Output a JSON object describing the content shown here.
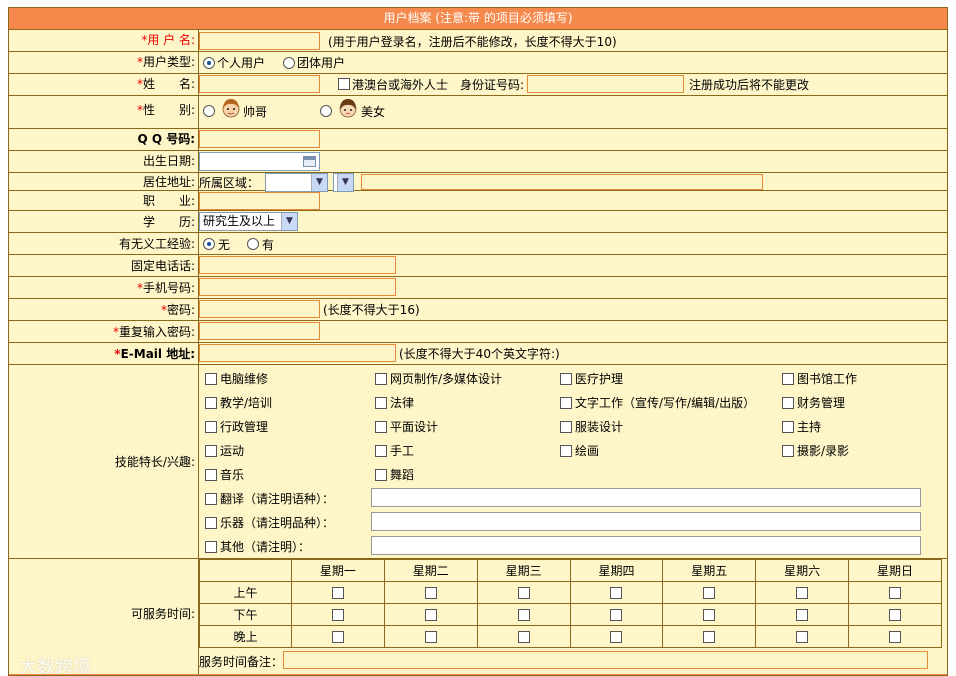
{
  "header": {
    "title": "用户档案 (注意:带 的项目必须填写)"
  },
  "fields": {
    "username": {
      "label": "用 户 名:",
      "hint": "(用于用户登录名，注册后不能修改，长度不得大于10)"
    },
    "usertype": {
      "label": "用户类型:",
      "options": [
        "个人用户",
        "团体用户"
      ],
      "selected": "个人用户"
    },
    "name": {
      "label": "姓　　名:",
      "hk_label": "港澳台或海外人士",
      "id_label": "身份证号码:",
      "id_hint": "注册成功后将不能更改"
    },
    "gender": {
      "label": "性　　别:",
      "options": [
        "帅哥",
        "美女"
      ]
    },
    "qq": {
      "label": "Q Q 号码:"
    },
    "birth": {
      "label": "出生日期:"
    },
    "address": {
      "label": "居住地址:",
      "region_label": "所属区域："
    },
    "job": {
      "label": "职　　业:"
    },
    "education": {
      "label": "学　　历:",
      "value": "研究生及以上"
    },
    "volunteer": {
      "label": "有无义工经验:",
      "options": [
        "无",
        "有"
      ],
      "selected": "无"
    },
    "phone": {
      "label": "固定电话话:"
    },
    "mobile": {
      "label": "手机号码:"
    },
    "password": {
      "label": "密码:",
      "hint": "(长度不得大于16)"
    },
    "password2": {
      "label": "重复输入密码:"
    },
    "email": {
      "label": "E-Mail 地址:",
      "hint": "(长度不得大于40个英文字符:)"
    }
  },
  "required_mark": "*",
  "skills": {
    "label": "技能特长/兴趣:",
    "items": [
      "电脑维修",
      "网页制作/多媒体设计",
      "医疗护理",
      "图书馆工作",
      "教学/培训",
      "法律",
      "文字工作（宣传/写作/编辑/出版）",
      "财务管理",
      "行政管理",
      "平面设计",
      "服装设计",
      "主持",
      "运动",
      "手工",
      "绘画",
      "摄影/录影",
      "音乐",
      "舞蹈"
    ],
    "other_items": [
      "翻译（请注明语种）：",
      "乐器（请注明品种）：",
      "其他（请注明）："
    ]
  },
  "schedule": {
    "label": "可服务时间:",
    "days": [
      "星期一",
      "星期二",
      "星期三",
      "星期四",
      "星期五",
      "星期六",
      "星期日"
    ],
    "slots": [
      "上午",
      "下午",
      "晚上"
    ],
    "note_label": "服务时间备注："
  },
  "watermark": "大数跨境",
  "colors": {
    "header": "#F4894B",
    "background": "#FEF5C8",
    "input_border": "#E4893A",
    "required": "#EE0000"
  }
}
